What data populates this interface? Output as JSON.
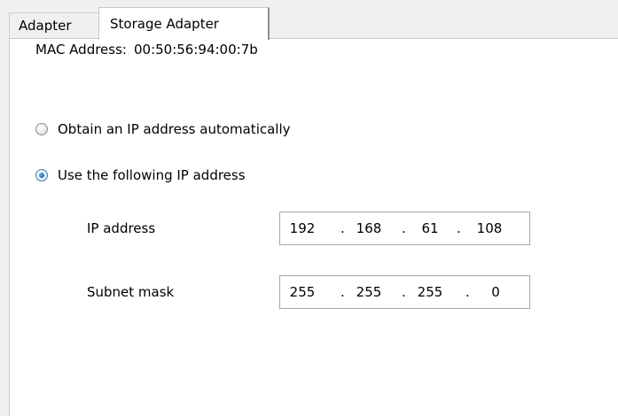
{
  "tabs": [
    {
      "label": "Adapter",
      "active": false
    },
    {
      "label": "Storage Adapter",
      "active": true
    }
  ],
  "mac": {
    "label": "MAC Address:",
    "value": "00:50:56:94:00:7b"
  },
  "ip_mode": {
    "options": [
      {
        "label": "Obtain an IP address automatically",
        "selected": false
      },
      {
        "label": "Use the following IP address",
        "selected": true
      }
    ]
  },
  "fields": {
    "ip_address": {
      "label": "IP address",
      "octets": [
        "192",
        "168",
        "61",
        "108"
      ]
    },
    "subnet_mask": {
      "label": "Subnet mask",
      "octets": [
        "255",
        "255",
        "255",
        "0"
      ]
    }
  },
  "separator": ".",
  "colors": {
    "background": "#f0f0f0",
    "panel": "#ffffff",
    "radio_selected": "#1e63b4"
  }
}
